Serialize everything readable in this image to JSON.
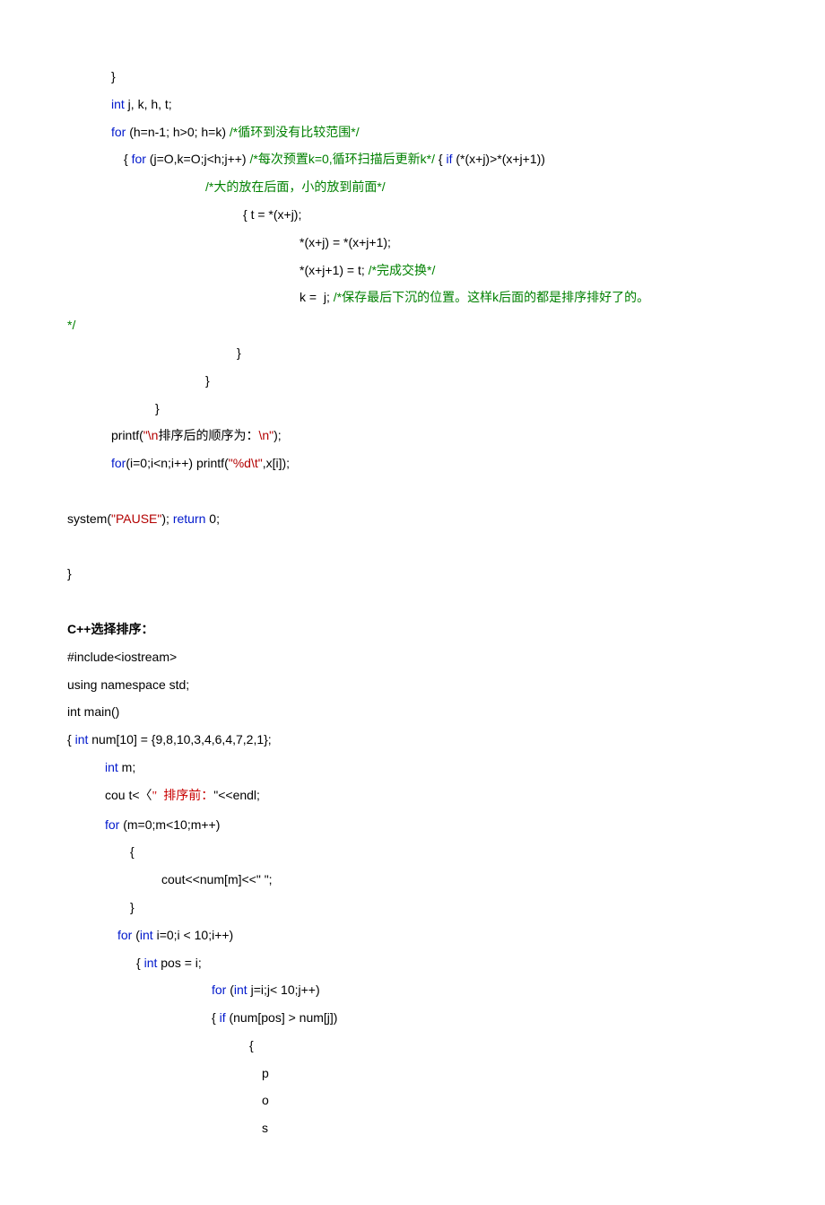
{
  "lines": [
    {
      "cls": "ind1",
      "parts": [
        {
          "t": "}"
        }
      ]
    },
    {
      "cls": "ind1",
      "parts": [
        {
          "t": "int",
          "c": "kw"
        },
        {
          "t": " j, k, h, t;"
        }
      ]
    },
    {
      "cls": "ind1",
      "parts": [
        {
          "t": "for",
          "c": "kw"
        },
        {
          "t": " (h=n-1; h>0; h=k) "
        },
        {
          "t": "/*循环到没有比较范围*/",
          "c": "cm-green"
        }
      ]
    },
    {
      "cls": "ind1b",
      "parts": [
        {
          "t": "{ "
        },
        {
          "t": "for",
          "c": "kw"
        },
        {
          "t": " (j=O,k=O;j<h;j++) "
        },
        {
          "t": "/*每次预置k=0,循环扫描后更新k*/",
          "c": "cm-green"
        },
        {
          "t": " { "
        },
        {
          "t": "if",
          "c": "kw"
        },
        {
          "t": " (*(x+j)>*(x+j+1))"
        }
      ]
    },
    {
      "cls": "ind3d",
      "parts": [
        {
          "t": "/*大的放在后面，小的放到前面*/",
          "c": "cm-green"
        }
      ]
    },
    {
      "cls": "ind3",
      "parts": [
        {
          "t": "{ t = *(x+j);"
        }
      ]
    },
    {
      "cls": "ind3b",
      "parts": [
        {
          "t": "*(x+j) = *(x+j+1);"
        }
      ]
    },
    {
      "cls": "ind3b",
      "parts": [
        {
          "t": "*(x+j+1) = t; "
        },
        {
          "t": "/*完成交换*/",
          "c": "cm-green"
        }
      ]
    },
    {
      "cls": "ind3b",
      "parts": [
        {
          "t": "k =  j; "
        },
        {
          "t": "/*保存最后下沉的位置。这样k后面的都是排序排好了的。",
          "c": "cm-green"
        }
      ]
    },
    {
      "cls": "",
      "parts": [
        {
          "t": "*/",
          "c": "cm-green"
        }
      ]
    },
    {
      "cls": "ind3c",
      "parts": [
        {
          "t": "}"
        }
      ]
    },
    {
      "cls": "ind3d",
      "parts": [
        {
          "t": "}"
        }
      ]
    },
    {
      "cls": "ind3e",
      "parts": [
        {
          "t": "}"
        }
      ]
    },
    {
      "cls": "ind1",
      "parts": [
        {
          "t": "printf("
        },
        {
          "t": "\"\\n",
          "c": "str-red"
        },
        {
          "t": "排序后的顺序为："
        },
        {
          "t": "\\n\"",
          "c": "str-red"
        },
        {
          "t": ");"
        }
      ]
    },
    {
      "cls": "ind1",
      "parts": [
        {
          "t": "for",
          "c": "kw"
        },
        {
          "t": "(i=0;i<n;i++) printf("
        },
        {
          "t": "\"%d\\t\"",
          "c": "str-red"
        },
        {
          "t": ",x[i]);"
        }
      ]
    },
    {
      "cls": "",
      "parts": [
        {
          "t": " "
        }
      ]
    },
    {
      "cls": "",
      "parts": [
        {
          "t": "system("
        },
        {
          "t": "\"PAUSE\"",
          "c": "str-red"
        },
        {
          "t": "); "
        },
        {
          "t": "return",
          "c": "kw"
        },
        {
          "t": " 0;"
        }
      ]
    },
    {
      "cls": "",
      "parts": [
        {
          "t": " "
        }
      ]
    },
    {
      "cls": "",
      "parts": [
        {
          "t": "}"
        }
      ]
    },
    {
      "cls": "",
      "parts": [
        {
          "t": " "
        }
      ]
    },
    {
      "cls": "bold",
      "parts": [
        {
          "t": "C++选择排序："
        }
      ]
    },
    {
      "cls": "",
      "parts": [
        {
          "t": "#include<iostream>"
        }
      ]
    },
    {
      "cls": "",
      "parts": [
        {
          "t": "using namespace std;"
        }
      ]
    },
    {
      "cls": "",
      "parts": [
        {
          "t": "int main()"
        }
      ]
    },
    {
      "cls": "",
      "parts": [
        {
          "t": "{ "
        },
        {
          "t": "int",
          "c": "kw"
        },
        {
          "t": " num[10] = {9,8,10,3,4,6,4,7,2,1};"
        }
      ]
    },
    {
      "cls": "ind4",
      "parts": [
        {
          "t": "int",
          "c": "kw"
        },
        {
          "t": " m;"
        }
      ]
    },
    {
      "cls": "ind4",
      "parts": [
        {
          "t": "cou t<〈"
        },
        {
          "t": "\"  排序前：",
          "c": "quote"
        },
        {
          "t": "\"<<endl;"
        }
      ]
    },
    {
      "cls": "ind4",
      "parts": [
        {
          "t": "for",
          "c": "kw"
        },
        {
          "t": " (m=0;m<10;m++)"
        }
      ]
    },
    {
      "cls": "ind5",
      "parts": [
        {
          "t": "{"
        }
      ]
    },
    {
      "cls": "ind6",
      "parts": [
        {
          "t": "cout<<num[m]<<\" \";"
        }
      ]
    },
    {
      "cls": "ind5",
      "parts": [
        {
          "t": "}"
        }
      ]
    },
    {
      "cls": "ind7",
      "parts": [
        {
          "t": "for",
          "c": "kw"
        },
        {
          "t": " ("
        },
        {
          "t": "int",
          "c": "kw"
        },
        {
          "t": " i=0;i < 10;i++)"
        }
      ]
    },
    {
      "cls": "ind8",
      "parts": [
        {
          "t": "{ "
        },
        {
          "t": "int",
          "c": "kw"
        },
        {
          "t": " pos = i;"
        }
      ]
    },
    {
      "cls": "ind9",
      "parts": [
        {
          "t": "for",
          "c": "kw"
        },
        {
          "t": " ("
        },
        {
          "t": "int",
          "c": "kw"
        },
        {
          "t": " j=i;j< 10;j++)"
        }
      ]
    },
    {
      "cls": "ind9",
      "parts": [
        {
          "t": "{ "
        },
        {
          "t": "if",
          "c": "kw"
        },
        {
          "t": " (num[pos] > num[j])"
        }
      ]
    },
    {
      "cls": "ind10",
      "parts": [
        {
          "t": "{"
        }
      ]
    },
    {
      "cls": "ind11",
      "parts": [
        {
          "t": "p"
        }
      ]
    },
    {
      "cls": "ind11",
      "parts": [
        {
          "t": "o"
        }
      ]
    },
    {
      "cls": "ind11",
      "parts": [
        {
          "t": "s"
        }
      ]
    }
  ]
}
